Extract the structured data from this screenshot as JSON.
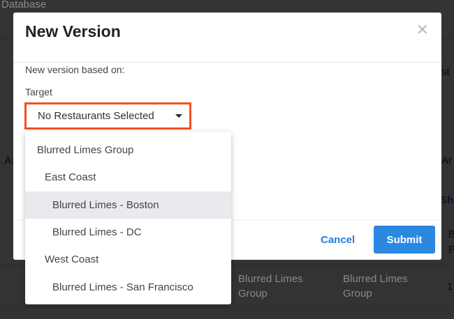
{
  "background": {
    "page_title": "Database",
    "right_text_1": "st",
    "link_left": "Ar",
    "text_right": "Ar",
    "link_right": "Sh",
    "right_col_1": "B",
    "right_col_2": "P",
    "row": {
      "col1": "Blurred Limes Group",
      "col2": "Blurred Limes Group",
      "col3": "1"
    }
  },
  "modal": {
    "title": "New Version",
    "close_icon": "close-icon",
    "based_on_label": "New version based on:",
    "target_label": "Target",
    "target_value": "No Restaurants Selected",
    "cancel_label": "Cancel",
    "submit_label": "Submit",
    "colors": {
      "accent": "#2a88e0",
      "focus_border": "#f4511e"
    }
  },
  "dropdown": {
    "items": [
      {
        "label": "Blurred Limes Group",
        "level": 0
      },
      {
        "label": "East Coast",
        "level": 1
      },
      {
        "label": "Blurred Limes - Boston",
        "level": 2,
        "highlighted": true
      },
      {
        "label": "Blurred Limes - DC",
        "level": 2
      },
      {
        "label": "West Coast",
        "level": 1
      },
      {
        "label": "Blurred Limes - San Francisco",
        "level": 2
      }
    ]
  }
}
